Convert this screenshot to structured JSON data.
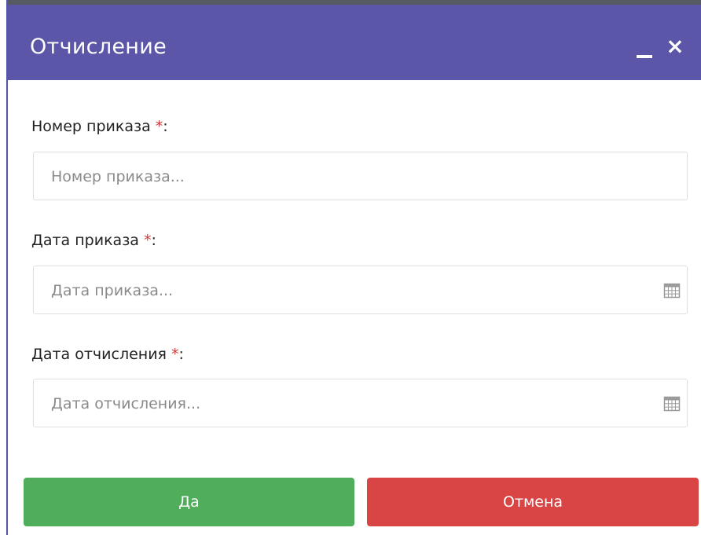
{
  "dialog": {
    "title": "Отчисление",
    "minimize_label": "_",
    "close_label": "×"
  },
  "fields": {
    "order_number": {
      "label": "Номер приказа",
      "required_mark": "*",
      "suffix": ":",
      "placeholder": "Номер приказа...",
      "value": ""
    },
    "order_date": {
      "label": "Дата приказа",
      "required_mark": "*",
      "suffix": ":",
      "placeholder": "Дата приказа...",
      "value": "",
      "icon": "calendar-icon"
    },
    "expulsion_date": {
      "label": "Дата отчисления",
      "required_mark": "*",
      "suffix": ":",
      "placeholder": "Дата отчисления...",
      "value": "",
      "icon": "calendar-icon"
    }
  },
  "buttons": {
    "yes": "Да",
    "cancel": "Отмена"
  },
  "colors": {
    "header": "#5b56a7",
    "yes_button": "#4fad5b",
    "cancel_button": "#d94545",
    "required": "#d0393c"
  }
}
